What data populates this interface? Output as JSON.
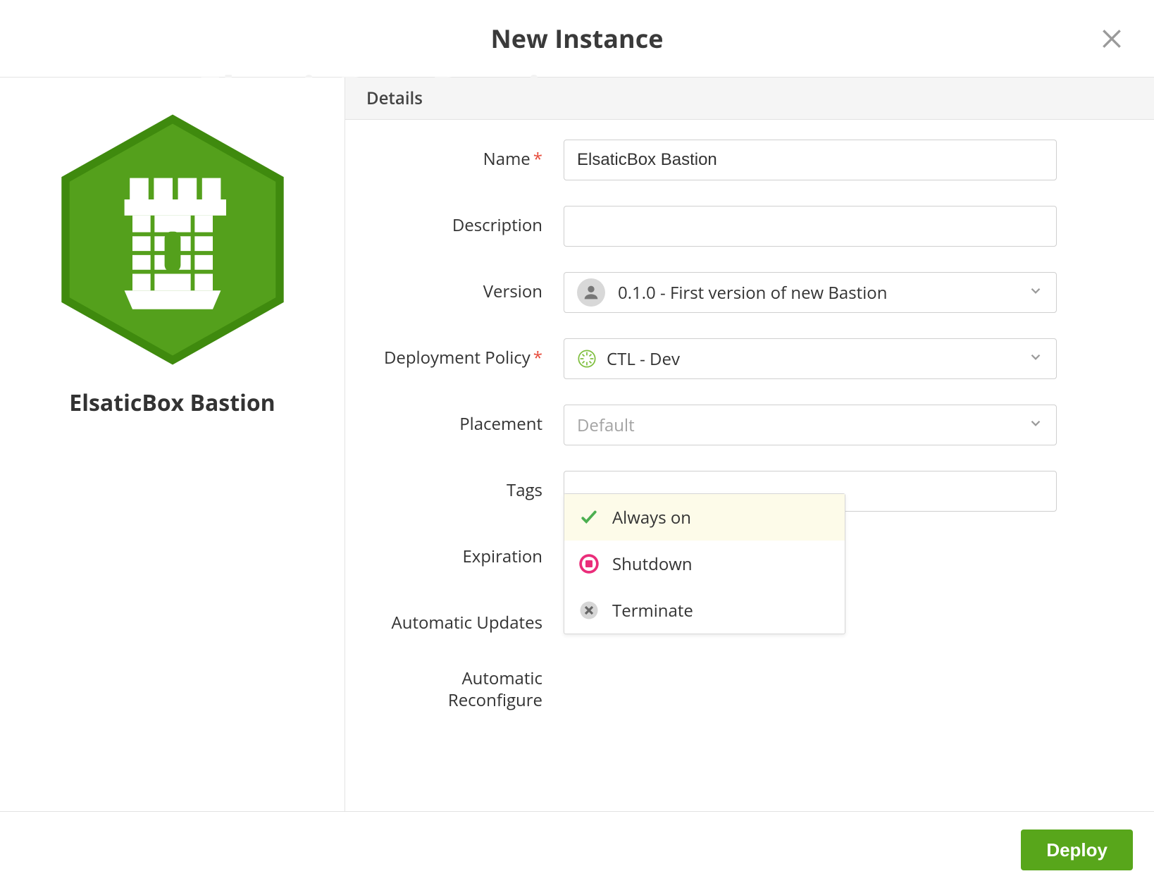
{
  "header": {
    "title": "New Instance"
  },
  "box": {
    "name": "ElsaticBox Bastion"
  },
  "section": {
    "details_label": "Details"
  },
  "form": {
    "name_label": "Name",
    "name_value": "ElsaticBox Bastion",
    "description_label": "Description",
    "description_value": "",
    "version_label": "Version",
    "version_value": "0.1.0 - First version of new Bastion",
    "deployment_label": "Deployment Policy",
    "deployment_value": "CTL - Dev",
    "placement_label": "Placement",
    "placement_placeholder": "Default",
    "tags_label": "Tags",
    "tags_value": "",
    "expiration_label": "Expiration",
    "expiration_value": "Always on",
    "auto_updates_label": "Automatic Updates",
    "auto_reconfigure_label": "Automatic Reconfigure",
    "required_mark": "*"
  },
  "expiration_options": [
    {
      "label": "Always on",
      "selected": true,
      "icon": "check"
    },
    {
      "label": "Shutdown",
      "selected": false,
      "icon": "stop"
    },
    {
      "label": "Terminate",
      "selected": false,
      "icon": "close-circle"
    }
  ],
  "footer": {
    "deploy_label": "Deploy"
  },
  "colors": {
    "accent_green": "#58a61b",
    "hex_green": "#54a01c",
    "hex_green_dark": "#3f8a0e",
    "pink": "#ea2d7a"
  }
}
